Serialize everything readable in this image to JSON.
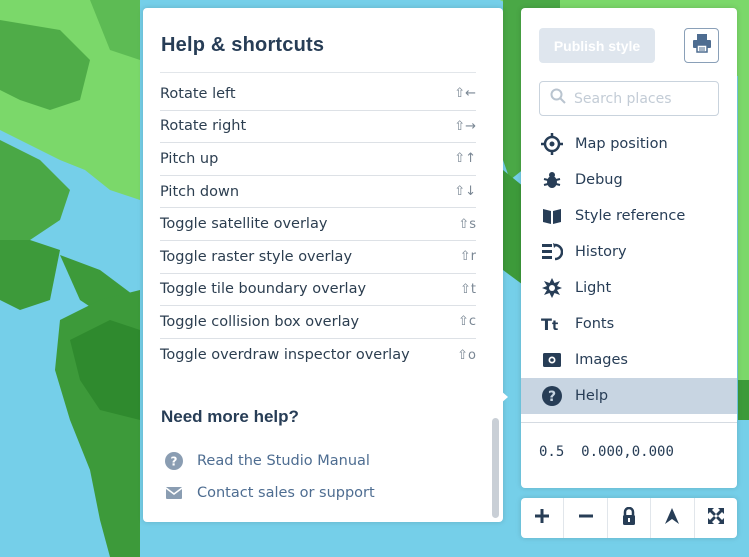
{
  "help": {
    "title": "Help & shortcuts",
    "shortcuts": [
      {
        "label": "Rotate left",
        "keys": "⇧←"
      },
      {
        "label": "Rotate right",
        "keys": "⇧→"
      },
      {
        "label": "Pitch up",
        "keys": "⇧↑"
      },
      {
        "label": "Pitch down",
        "keys": "⇧↓"
      },
      {
        "label": "Toggle satellite overlay",
        "keys": "⇧s"
      },
      {
        "label": "Toggle raster style overlay",
        "keys": "⇧r"
      },
      {
        "label": "Toggle tile boundary overlay",
        "keys": "⇧t"
      },
      {
        "label": "Toggle collision box overlay",
        "keys": "⇧c"
      },
      {
        "label": "Toggle overdraw inspector overlay",
        "keys": "⇧o"
      }
    ],
    "need_more_help": "Need more help?",
    "links": [
      {
        "label": "Read the Studio Manual",
        "icon": "question-icon"
      },
      {
        "label": "Contact sales or support",
        "icon": "envelope-icon"
      }
    ]
  },
  "toolbar": {
    "publish_label": "Publish style",
    "print_icon": "print-icon",
    "search_placeholder": "Search places",
    "menu": [
      {
        "label": "Map position",
        "icon": "crosshair-icon",
        "active": false
      },
      {
        "label": "Debug",
        "icon": "bug-icon",
        "active": false
      },
      {
        "label": "Style reference",
        "icon": "book-icon",
        "active": false
      },
      {
        "label": "History",
        "icon": "history-icon",
        "active": false
      },
      {
        "label": "Light",
        "icon": "sun-icon",
        "active": false
      },
      {
        "label": "Fonts",
        "icon": "font-icon",
        "active": false
      },
      {
        "label": "Images",
        "icon": "image-icon",
        "active": false
      },
      {
        "label": "Help",
        "icon": "help-icon",
        "active": true
      }
    ],
    "coordinates": {
      "zoom": "0.5",
      "latlng": "0.000,0.000"
    }
  },
  "map_controls": [
    {
      "label": "+",
      "icon": "zoom-in-icon"
    },
    {
      "label": "−",
      "icon": "zoom-out-icon"
    },
    {
      "label": "lock",
      "icon": "lock-icon"
    },
    {
      "label": "north",
      "icon": "compass-icon"
    },
    {
      "label": "fullscreen",
      "icon": "fullscreen-icon"
    }
  ],
  "colors": {
    "ocean": "#75cfe9",
    "land": "#7bd86a",
    "forest": "#3d9a3a",
    "text": "#273d56",
    "link": "#4e6d91",
    "active": "#c8d5e2"
  }
}
